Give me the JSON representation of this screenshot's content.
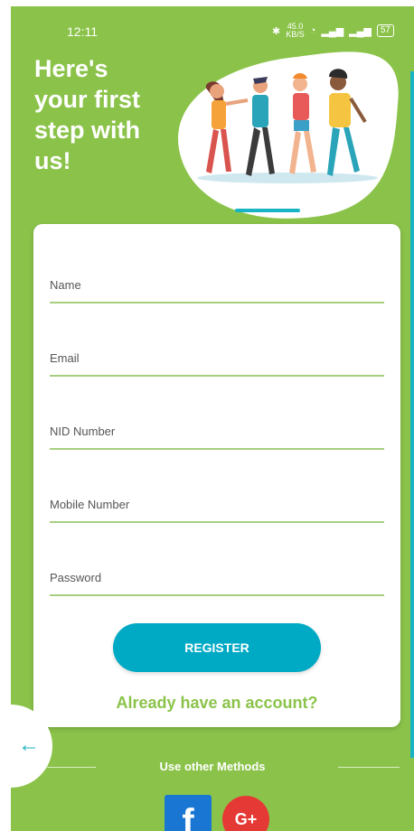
{
  "status_bar": {
    "time": "12:11",
    "net_speed": "45.0",
    "net_unit": "KB/S",
    "battery": "57"
  },
  "hero": {
    "line1": "Here's",
    "line2": "your first",
    "line3": "step with",
    "line4": "us!"
  },
  "form": {
    "fields": [
      {
        "label": "Name"
      },
      {
        "label": "Email"
      },
      {
        "label": "NID Number"
      },
      {
        "label": "Mobile Number"
      },
      {
        "label": "Password"
      }
    ],
    "register_label": "REGISTER",
    "already_account": "Already have an account?"
  },
  "footer": {
    "other_methods": "Use other Methods",
    "facebook_glyph": "f",
    "google_glyph": "G+"
  },
  "icons": {
    "back": "arrow-left-icon",
    "facebook": "facebook-icon",
    "google": "google-plus-icon"
  },
  "colors": {
    "background": "#8bc34a",
    "accent": "#00a9c4",
    "field_underline": "#a6cf80",
    "facebook": "#1976d2",
    "google": "#e53935"
  }
}
